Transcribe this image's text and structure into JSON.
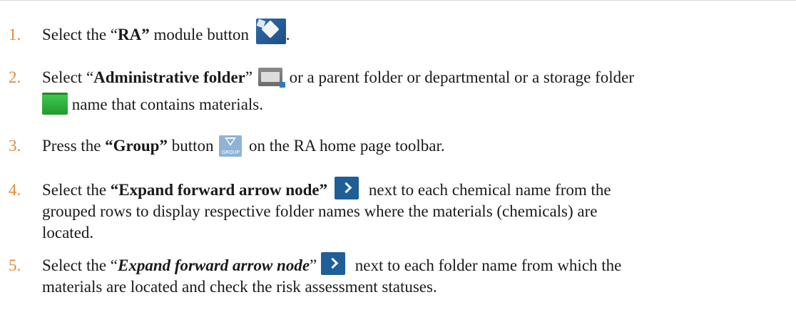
{
  "steps": [
    {
      "num": "1.",
      "pre": "Select the “",
      "bold": "RA”",
      "post": " module button",
      "trail": ".",
      "icon": "ra-dice-icon"
    },
    {
      "num": "2.",
      "pre": "Select “",
      "bold": "Administrative folder",
      "mid": "” ",
      "post": " or a parent folder or departmental or a storage folder",
      "line2": " name that contains materials.",
      "icons": [
        "admin-folder-icon",
        "storage-folder-icon"
      ]
    },
    {
      "num": "3.",
      "pre": "Press the ",
      "bold": "“Group”",
      "mid": " button ",
      "icon_label": "GROUP",
      "post": " on the RA home page toolbar.",
      "icon": "group-icon"
    },
    {
      "num": "4.",
      "pre": "Select the ",
      "bold": "“Expand forward arrow node”",
      "post": " next to each chemical name from the",
      "line2": "grouped rows to display respective folder names where the materials (chemicals) are",
      "line3": "located.",
      "icon": "expand-arrow-icon"
    },
    {
      "num": "5.",
      "pre": "Select the “",
      "bold": "Expand forward arrow node",
      "mid": "” ",
      "post": " next to each folder name from which the",
      "line2": "materials are located and check the risk assessment statuses.",
      "icon": "expand-arrow-icon"
    }
  ]
}
